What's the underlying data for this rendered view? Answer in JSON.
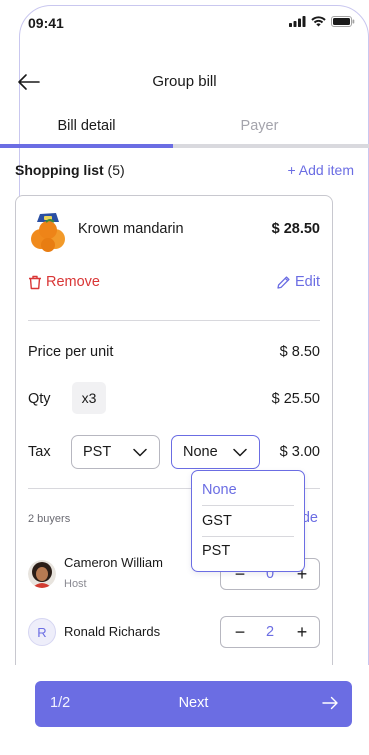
{
  "status_bar": {
    "time": "09:41"
  },
  "header": {
    "title": "Group bill"
  },
  "tabs": [
    {
      "label": "Bill detail"
    },
    {
      "label": "Payer"
    }
  ],
  "shopping_list": {
    "title": "Shopping list",
    "count": "(5)",
    "add_item": "+ Add item"
  },
  "item": {
    "name": "Krown mandarin",
    "total": "$ 28.50",
    "remove_label": "Remove",
    "edit_label": "Edit",
    "price_per_unit_label": "Price per unit",
    "price_per_unit": "$ 8.50",
    "qty_label": "Qty",
    "qty": "x3",
    "qty_total": "$ 25.50",
    "tax_label": "Tax",
    "tax_type": "PST",
    "tax_option": "None",
    "tax_total": "$ 3.00"
  },
  "tax_dropdown": {
    "options": [
      "None",
      "GST",
      "PST"
    ],
    "selected": "None"
  },
  "buyers": {
    "label": "2 buyers",
    "hide_label": "Hide",
    "list": [
      {
        "name": "Cameron William",
        "role": "Host",
        "qty": "0"
      },
      {
        "initial": "R",
        "name": "Ronald Richards",
        "qty": "2"
      }
    ]
  },
  "footer": {
    "page_indicator": "1/2",
    "next_label": "Next"
  },
  "colors": {
    "accent": "#6b6de3",
    "danger": "#d93636",
    "border": "#c8c8cf"
  }
}
